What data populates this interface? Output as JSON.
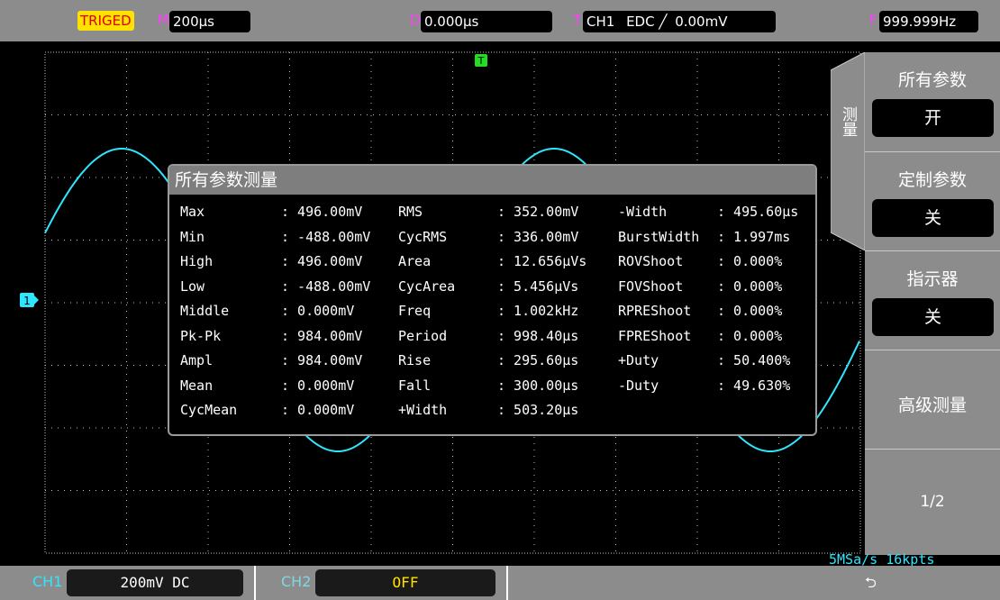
{
  "topbar": {
    "trigger_status": "TRIGED",
    "timebase_label": "M",
    "timebase_value": "200µs",
    "delay_label": "D",
    "delay_value": "0.000µs",
    "trigger_label": "T",
    "trigger_source": "CH1",
    "trigger_coupling": "EDC",
    "trigger_level": "0.00mV",
    "freq_label": "F",
    "freq_value": "999.999Hz"
  },
  "screen": {
    "trigger_marker": "T",
    "channel_marker": "1",
    "sample_info": "5MSa/s 16kpts",
    "waveform_color": "#2fe6ff"
  },
  "popup": {
    "title": "所有参数测量",
    "columns": [
      [
        {
          "name": "Max",
          "value": ": 496.00mV"
        },
        {
          "name": "Min",
          "value": ": -488.00mV"
        },
        {
          "name": "High",
          "value": ": 496.00mV"
        },
        {
          "name": "Low",
          "value": ": -488.00mV"
        },
        {
          "name": "Middle",
          "value": ": 0.000mV"
        },
        {
          "name": "Pk-Pk",
          "value": ": 984.00mV"
        },
        {
          "name": "Ampl",
          "value": ": 984.00mV"
        },
        {
          "name": "Mean",
          "value": ": 0.000mV"
        },
        {
          "name": "CycMean",
          "value": ": 0.000mV"
        }
      ],
      [
        {
          "name": "RMS",
          "value": ": 352.00mV"
        },
        {
          "name": "CycRMS",
          "value": ": 336.00mV"
        },
        {
          "name": "Area",
          "value": ": 12.656µVs"
        },
        {
          "name": "CycArea",
          "value": ": 5.456µVs"
        },
        {
          "name": "Freq",
          "value": ": 1.002kHz"
        },
        {
          "name": "Period",
          "value": ": 998.40µs"
        },
        {
          "name": "Rise",
          "value": ": 295.60µs"
        },
        {
          "name": "Fall",
          "value": ": 300.00µs"
        },
        {
          "name": "+Width",
          "value": ": 503.20µs"
        }
      ],
      [
        {
          "name": "-Width",
          "value": ": 495.60µs"
        },
        {
          "name": "BurstWidth",
          "value": ": 1.997ms"
        },
        {
          "name": "ROVShoot",
          "value": ": 0.000%"
        },
        {
          "name": "FOVShoot",
          "value": ": 0.000%"
        },
        {
          "name": "RPREShoot",
          "value": ": 0.000%"
        },
        {
          "name": "FPREShoot",
          "value": ": 0.000%"
        },
        {
          "name": "+Duty",
          "value": ": 50.400%"
        },
        {
          "name": "-Duty",
          "value": ": 49.630%"
        }
      ]
    ]
  },
  "menu": {
    "tab_label": "测量",
    "all_params_label": "所有参数",
    "all_params_value": "开",
    "custom_params_label": "定制参数",
    "custom_params_value": "关",
    "indicator_label": "指示器",
    "indicator_value": "关",
    "advanced_label": "高级测量",
    "page": "1/2"
  },
  "bottombar": {
    "ch1_label": "CH1",
    "ch1_value": "200mV DC",
    "ch2_label": "CH2",
    "ch2_value": "OFF",
    "usb_icon": "usb-icon"
  },
  "colors": {
    "background": "#000000",
    "bar_gray": "#8c8c8c",
    "channel_cyan": "#2fe6ff",
    "trigger_green": "#22dd22",
    "trig_yellow": "#ffe200",
    "label_magenta": "#ff3fff"
  }
}
